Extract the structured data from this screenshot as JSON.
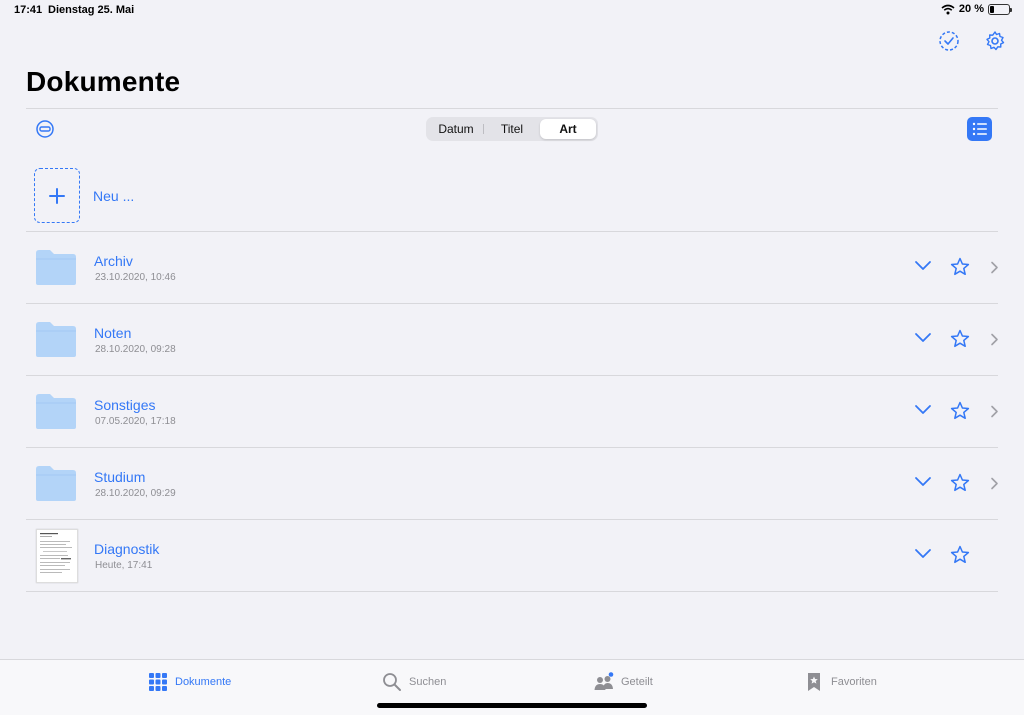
{
  "status": {
    "time": "17:41",
    "date": "Dienstag 25. Mai",
    "battery_percent_label": "20 %",
    "battery_level": 0.2
  },
  "header": {
    "title": "Dokumente",
    "icons": [
      "select-checkmark-icon",
      "settings-gear-icon"
    ]
  },
  "toolbar": {
    "sort_segments": [
      "Datum",
      "Titel",
      "Art"
    ],
    "selected_segment": "Art",
    "left_icon": "collapse-minus-icon",
    "right_icon": "list-view-icon"
  },
  "new_item": {
    "label": "Neu ..."
  },
  "items": [
    {
      "name": "Archiv",
      "date": "23.10.2020, 10:46",
      "type": "folder",
      "icon": "folder-icon"
    },
    {
      "name": "Noten",
      "date": "28.10.2020, 09:28",
      "type": "folder",
      "icon": "folder-icon"
    },
    {
      "name": "Sonstiges",
      "date": "07.05.2020, 17:18",
      "type": "folder",
      "icon": "folder-icon"
    },
    {
      "name": "Studium",
      "date": "28.10.2020, 09:29",
      "type": "folder",
      "icon": "folder-icon"
    },
    {
      "name": "Diagnostik",
      "date": "Heute, 17:41",
      "type": "document",
      "icon": "document-thumbnail"
    }
  ],
  "tabbar": {
    "tabs": [
      {
        "label": "Dokumente",
        "icon": "grid-icon",
        "active": true
      },
      {
        "label": "Suchen",
        "icon": "search-icon",
        "active": false
      },
      {
        "label": "Geteilt",
        "icon": "people-icon",
        "active": false
      },
      {
        "label": "Favoriten",
        "icon": "bookmark-star-icon",
        "active": false
      }
    ]
  },
  "colors": {
    "accent": "#3478f6",
    "background": "#f2f2f7",
    "folder": "#b3d4f8",
    "secondary_text": "#8e8e93"
  }
}
